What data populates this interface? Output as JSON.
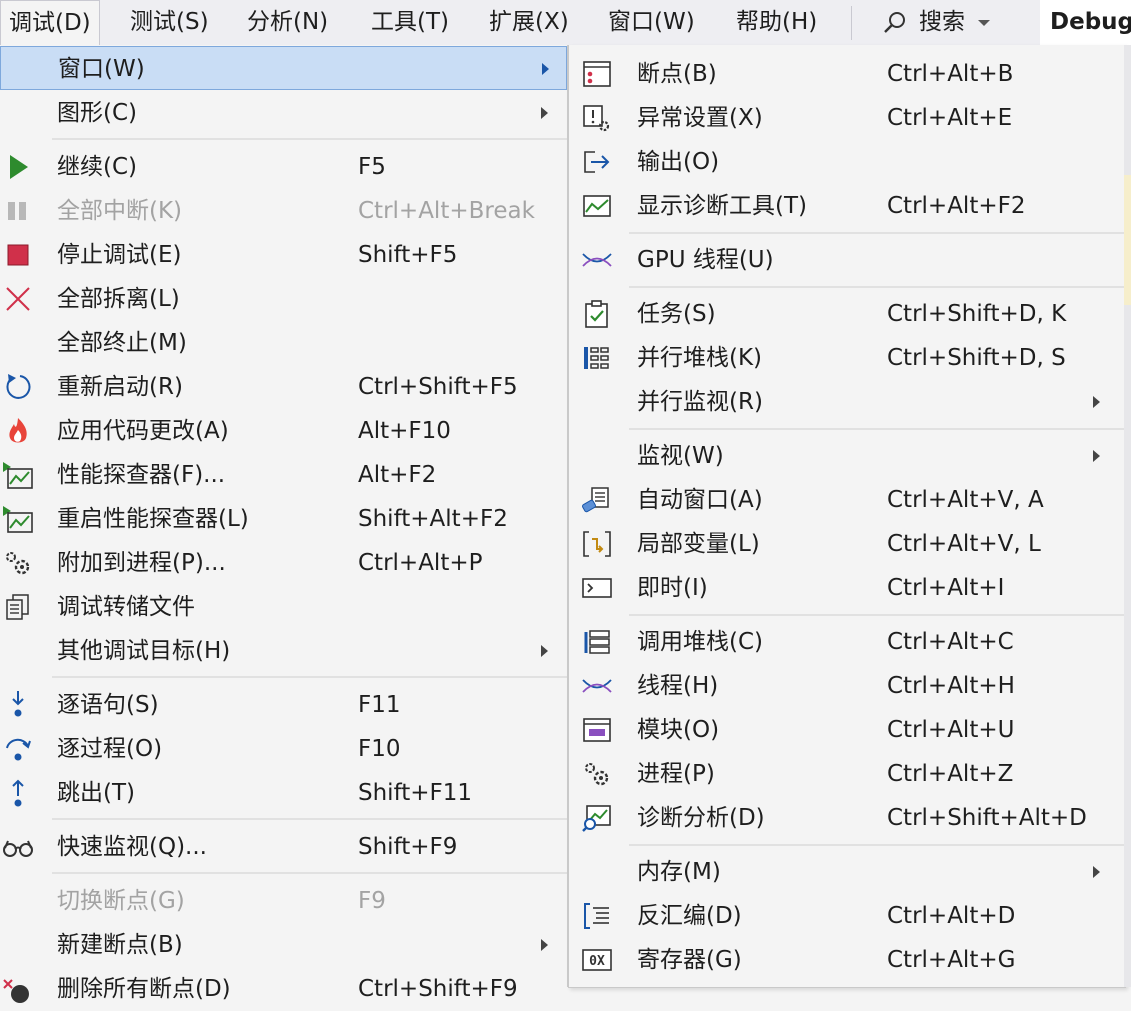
{
  "menubar": {
    "items": [
      {
        "label": "调试(D)",
        "active": true
      },
      {
        "label": "测试(S)"
      },
      {
        "label": "分析(N)"
      },
      {
        "label": "工具(T)"
      },
      {
        "label": "扩展(X)"
      },
      {
        "label": "窗口(W)"
      },
      {
        "label": "帮助(H)"
      }
    ],
    "search_label": "搜索",
    "config_label": "Debug"
  },
  "debug_menu": {
    "items": [
      {
        "label": "窗口(W)",
        "shortcut": "",
        "icon": "none",
        "submenu": true,
        "highlight": true
      },
      {
        "label": "图形(C)",
        "shortcut": "",
        "icon": "none",
        "submenu": true
      },
      {
        "label": "继续(C)",
        "shortcut": "F5",
        "icon": "play-icon"
      },
      {
        "label": "全部中断(K)",
        "shortcut": "Ctrl+Alt+Break",
        "icon": "pause-icon",
        "disabled": true
      },
      {
        "label": "停止调试(E)",
        "shortcut": "Shift+F5",
        "icon": "stop-icon"
      },
      {
        "label": "全部拆离(L)",
        "shortcut": "",
        "icon": "detach-x-icon"
      },
      {
        "label": "全部终止(M)",
        "shortcut": "",
        "icon": "none"
      },
      {
        "label": "重新启动(R)",
        "shortcut": "Ctrl+Shift+F5",
        "icon": "restart-icon"
      },
      {
        "label": "应用代码更改(A)",
        "shortcut": "Alt+F10",
        "icon": "hot-reload-flame-icon"
      },
      {
        "label": "性能探查器(F)...",
        "shortcut": "Alt+F2",
        "icon": "profiler-icon"
      },
      {
        "label": "重启性能探查器(L)",
        "shortcut": "Shift+Alt+F2",
        "icon": "profiler-restart-icon"
      },
      {
        "label": "附加到进程(P)...",
        "shortcut": "Ctrl+Alt+P",
        "icon": "gears-icon"
      },
      {
        "label": "调试转储文件",
        "shortcut": "",
        "icon": "dump-file-icon"
      },
      {
        "label": "其他调试目标(H)",
        "shortcut": "",
        "icon": "none",
        "submenu": true
      },
      {
        "label": "逐语句(S)",
        "shortcut": "F11",
        "icon": "step-into-icon"
      },
      {
        "label": "逐过程(O)",
        "shortcut": "F10",
        "icon": "step-over-icon"
      },
      {
        "label": "跳出(T)",
        "shortcut": "Shift+F11",
        "icon": "step-out-icon"
      },
      {
        "label": "快速监视(Q)...",
        "shortcut": "Shift+F9",
        "icon": "glasses-icon"
      },
      {
        "label": "切换断点(G)",
        "shortcut": "F9",
        "icon": "none",
        "disabled": true
      },
      {
        "label": "新建断点(B)",
        "shortcut": "",
        "icon": "none",
        "submenu": true
      },
      {
        "label": "删除所有断点(D)",
        "shortcut": "Ctrl+Shift+F9",
        "icon": "delete-breakpoints-icon"
      }
    ]
  },
  "window_submenu": {
    "items": [
      {
        "label": "断点(B)",
        "shortcut": "Ctrl+Alt+B",
        "icon": "breakpoints-window-icon"
      },
      {
        "label": "异常设置(X)",
        "shortcut": "Ctrl+Alt+E",
        "icon": "exception-settings-icon"
      },
      {
        "label": "输出(O)",
        "shortcut": "",
        "icon": "output-icon"
      },
      {
        "label": "显示诊断工具(T)",
        "shortcut": "Ctrl+Alt+F2",
        "icon": "diagnostic-tools-icon"
      },
      {
        "label": "GPU 线程(U)",
        "shortcut": "",
        "icon": "gpu-threads-icon"
      },
      {
        "label": "任务(S)",
        "shortcut": "Ctrl+Shift+D, K",
        "icon": "tasks-icon"
      },
      {
        "label": "并行堆栈(K)",
        "shortcut": "Ctrl+Shift+D, S",
        "icon": "parallel-stacks-icon"
      },
      {
        "label": "并行监视(R)",
        "shortcut": "",
        "icon": "none",
        "submenu": true
      },
      {
        "label": "监视(W)",
        "shortcut": "",
        "icon": "none",
        "submenu": true
      },
      {
        "label": "自动窗口(A)",
        "shortcut": "Ctrl+Alt+V, A",
        "icon": "autos-icon"
      },
      {
        "label": "局部变量(L)",
        "shortcut": "Ctrl+Alt+V, L",
        "icon": "locals-icon"
      },
      {
        "label": "即时(I)",
        "shortcut": "Ctrl+Alt+I",
        "icon": "immediate-icon"
      },
      {
        "label": "调用堆栈(C)",
        "shortcut": "Ctrl+Alt+C",
        "icon": "call-stack-icon"
      },
      {
        "label": "线程(H)",
        "shortcut": "Ctrl+Alt+H",
        "icon": "threads-icon"
      },
      {
        "label": "模块(O)",
        "shortcut": "Ctrl+Alt+U",
        "icon": "modules-icon"
      },
      {
        "label": "进程(P)",
        "shortcut": "Ctrl+Alt+Z",
        "icon": "processes-icon"
      },
      {
        "label": "诊断分析(D)",
        "shortcut": "Ctrl+Shift+Alt+D",
        "icon": "diagnostic-analysis-icon"
      },
      {
        "label": "内存(M)",
        "shortcut": "",
        "icon": "none",
        "submenu": true
      },
      {
        "label": "反汇编(D)",
        "shortcut": "Ctrl+Alt+D",
        "icon": "disassembly-icon"
      },
      {
        "label": "寄存器(G)",
        "shortcut": "Ctrl+Alt+G",
        "icon": "registers-icon",
        "icon_text": "0X"
      }
    ]
  },
  "colors": {
    "accent": "#1a56a8",
    "highlight": "#c9ddf5",
    "play": "#2e8b2e",
    "stop": "#d0304a"
  }
}
